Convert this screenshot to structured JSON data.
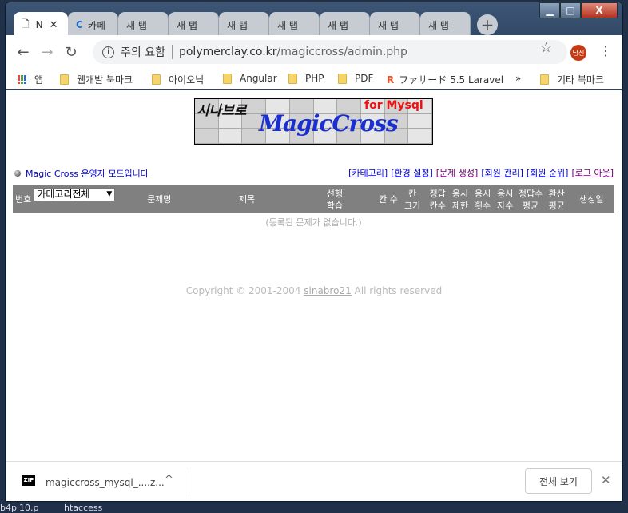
{
  "window": {
    "minimize": "▁",
    "maximize": "□",
    "close": "X"
  },
  "tabs": [
    {
      "label": "N",
      "close": "✕"
    },
    {
      "label": "카페"
    },
    {
      "label": "새 탭"
    },
    {
      "label": "새 탭"
    },
    {
      "label": "새 탭"
    },
    {
      "label": "새 탭"
    },
    {
      "label": "새 탭"
    },
    {
      "label": "새 탭"
    },
    {
      "label": "새 탭"
    }
  ],
  "new_tab": "+",
  "toolbar": {
    "back": "←",
    "forward": "→",
    "reload": "↻",
    "security": "주의 요함",
    "domain": "polymerclay.co.kr",
    "path": "/magiccross/admin.php",
    "star": "☆",
    "avatar": "남신",
    "menu": "⋮"
  },
  "bookmarks": {
    "items": [
      "앱",
      "웹개발 북마크",
      "아이오닉",
      "Angular",
      "PHP",
      "PDF",
      "ファサード 5.5 Laravel"
    ],
    "more": "»",
    "other": "기타 북마크"
  },
  "logo": {
    "korean": "시나브로",
    "for": "for Mysql",
    "title": "MagicCross"
  },
  "page": {
    "mode": "Magic Cross 운영자 모드입니다",
    "links": [
      "[카테고리]",
      "[환경 설정]",
      "[문제 생성]",
      "[회원 관리]",
      "[회원 순위]",
      "[로그 아웃]"
    ],
    "table": {
      "headers": [
        "번호",
        "",
        "문제명",
        "제목",
        "선행\n학습",
        "칸 수",
        "칸\n크기",
        "정답\n칸수",
        "응시\n제한",
        "응시\n횟수",
        "응시\n자수",
        "정답수\n평균",
        "환산\n평균",
        "생성일"
      ],
      "category_select": "카테고리전체",
      "empty": "(등록된 문제가 없습니다.)"
    },
    "copyright_pre": "Copyright © 2001-2004 ",
    "copyright_link": "sinabro21",
    "copyright_post": " All rights reserved"
  },
  "download": {
    "icon": "ZIP",
    "filename": "magiccross_mysql_....z...",
    "caret": "^",
    "show_all": "전체 보기",
    "close": "✕"
  },
  "desktop": [
    "b4pl10.p",
    "htaccess"
  ]
}
